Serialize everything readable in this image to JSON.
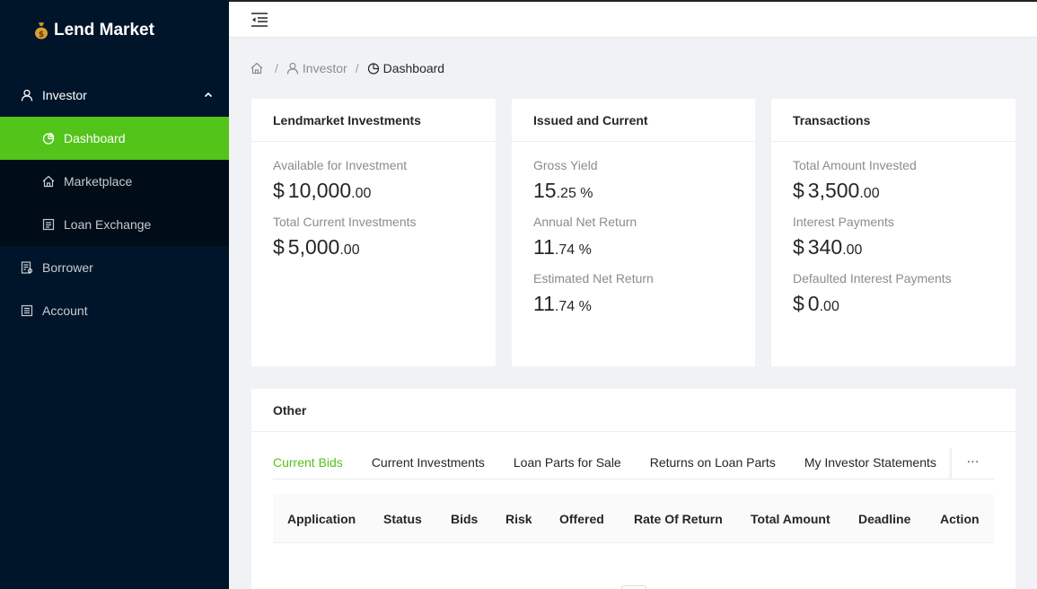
{
  "app": {
    "name": "Lend Market"
  },
  "sidebar": {
    "items": [
      {
        "label": "Investor",
        "icon": "user-icon",
        "expanded": true
      },
      {
        "label": "Dashboard",
        "icon": "pie-chart-icon",
        "active": true
      },
      {
        "label": "Marketplace",
        "icon": "home-icon"
      },
      {
        "label": "Loan Exchange",
        "icon": "list-icon"
      },
      {
        "label": "Borrower",
        "icon": "audit-icon"
      },
      {
        "label": "Account",
        "icon": "profile-icon"
      }
    ]
  },
  "breadcrumb": {
    "sep": "/",
    "items": [
      "Investor",
      "Dashboard"
    ]
  },
  "cards": {
    "investments": {
      "title": "Lendmarket Investments",
      "stats": [
        {
          "label": "Available for Investment",
          "currency": "$",
          "main": "10,000",
          "fraction": ".00"
        },
        {
          "label": "Total Current Investments",
          "currency": "$",
          "main": "5,000",
          "fraction": ".00"
        }
      ]
    },
    "issued": {
      "title": "Issued and Current",
      "stats": [
        {
          "label": "Gross Yield",
          "main": "15",
          "fraction": ".25 %"
        },
        {
          "label": "Annual Net Return",
          "main": "11",
          "fraction": ".74 %"
        },
        {
          "label": "Estimated Net Return",
          "main": "11",
          "fraction": ".74 %"
        }
      ]
    },
    "transactions": {
      "title": "Transactions",
      "stats": [
        {
          "label": "Total Amount Invested",
          "currency": "$",
          "main": "3,500",
          "fraction": ".00"
        },
        {
          "label": "Interest Payments",
          "currency": "$",
          "main": "340",
          "fraction": ".00"
        },
        {
          "label": "Defaulted Interest Payments",
          "currency": "$",
          "main": "0",
          "fraction": ".00"
        }
      ]
    },
    "other": {
      "title": "Other",
      "tabs": [
        "Current Bids",
        "Current Investments",
        "Loan Parts for Sale",
        "Returns on Loan Parts",
        "My Investor Statements"
      ],
      "more": "···",
      "columns": [
        "Application",
        "Status",
        "Bids",
        "Risk",
        "Offered",
        "Rate Of Return",
        "Total Amount",
        "Deadline",
        "Action"
      ]
    }
  },
  "colors": {
    "sidebar_bg": "#001529",
    "accent": "#52c41a"
  }
}
